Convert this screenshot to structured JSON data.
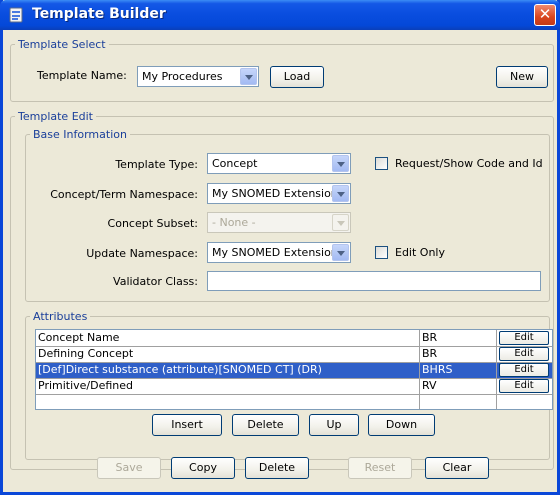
{
  "window": {
    "title": "Template Builder",
    "close_glyph": "✕"
  },
  "template_select": {
    "legend": "Template Select",
    "name_label": "Template Name:",
    "name_value": "My Procedures",
    "load_label": "Load",
    "new_label": "New"
  },
  "template_edit": {
    "legend": "Template Edit",
    "base_info": {
      "legend": "Base Information",
      "type_label": "Template Type:",
      "type_value": "Concept",
      "request_show_label": "Request/Show Code and Id",
      "namespace_label": "Concept/Term Namespace:",
      "namespace_value": "My SNOMED Extension",
      "subset_label": "Concept Subset:",
      "subset_value": "- None -",
      "update_ns_label": "Update Namespace:",
      "update_ns_value": "My SNOMED Extension",
      "edit_only_label": "Edit Only",
      "validator_label": "Validator Class:",
      "validator_value": ""
    },
    "attributes": {
      "legend": "Attributes",
      "rows": [
        {
          "name": "Concept Name",
          "code": "BR",
          "action": "Edit"
        },
        {
          "name": "Defining Concept",
          "code": "BR",
          "action": "Edit"
        },
        {
          "name": "[Def]Direct substance (attribute)[SNOMED CT] (DR)",
          "code": "BHRS",
          "action": "Edit"
        },
        {
          "name": "Primitive/Defined",
          "code": "RV",
          "action": "Edit"
        }
      ],
      "insert_label": "Insert",
      "delete_label": "Delete",
      "up_label": "Up",
      "down_label": "Down"
    }
  },
  "footer": {
    "save_label": "Save",
    "copy_label": "Copy",
    "delete_label": "Delete",
    "reset_label": "Reset",
    "clear_label": "Clear"
  },
  "colors": {
    "titlebar": "#0448d8",
    "selection": "#2f5fc8",
    "legend_text": "#1a3f9a",
    "close_button": "#d9451f"
  },
  "icons": [
    "app-icon",
    "close-icon",
    "dropdown-arrow-icon"
  ]
}
